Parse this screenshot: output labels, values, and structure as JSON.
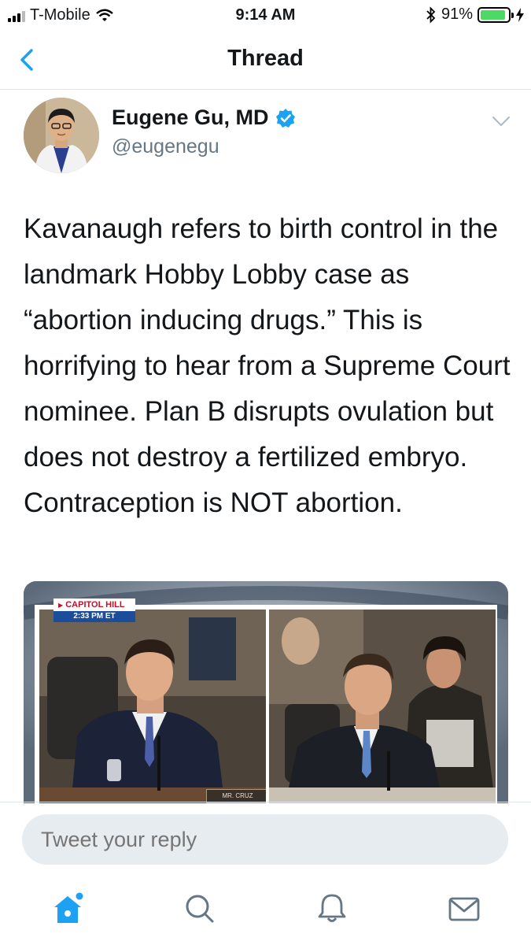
{
  "status_bar": {
    "carrier": "T-Mobile",
    "time": "9:14 AM",
    "battery": "91%",
    "battery_level": 0.91,
    "icons": [
      "signal-bars-icon",
      "wifi-icon",
      "bluetooth-icon",
      "battery-icon",
      "charging-icon"
    ]
  },
  "nav": {
    "title": "Thread",
    "back_icon": "chevron-left-icon"
  },
  "tweet": {
    "author_name": "Eugene Gu, MD",
    "handle": "@eugenegu",
    "verified_icon": "verified-badge-icon",
    "menu_icon": "chevron-down-icon",
    "text": "Kavanaugh refers to birth control in the landmark Hobby Lobby case as “abortion inducing drugs.” This is horrifying to hear from a Supreme Court nominee. Plan B disrupts ovulation but does not destroy a fertilized embryo. Contraception is NOT abortion.",
    "media": {
      "chyron_location": "CAPITOL HILL",
      "chyron_time": "2:33 PM ET",
      "nameplate": "MR. CRUZ"
    }
  },
  "reply": {
    "placeholder": "Tweet your reply"
  },
  "tab_bar": {
    "tabs": [
      {
        "name": "home",
        "icon": "home-icon",
        "active": true
      },
      {
        "name": "search",
        "icon": "search-icon",
        "active": false
      },
      {
        "name": "notifications",
        "icon": "bell-icon",
        "active": false
      },
      {
        "name": "messages",
        "icon": "mail-icon",
        "active": false
      }
    ]
  },
  "colors": {
    "accent": "#1da1f2",
    "text_primary": "#14171a",
    "text_secondary": "#657786",
    "input_bg": "#e6ecf0",
    "divider": "#e1e8ed",
    "battery_green": "#4cd964"
  }
}
